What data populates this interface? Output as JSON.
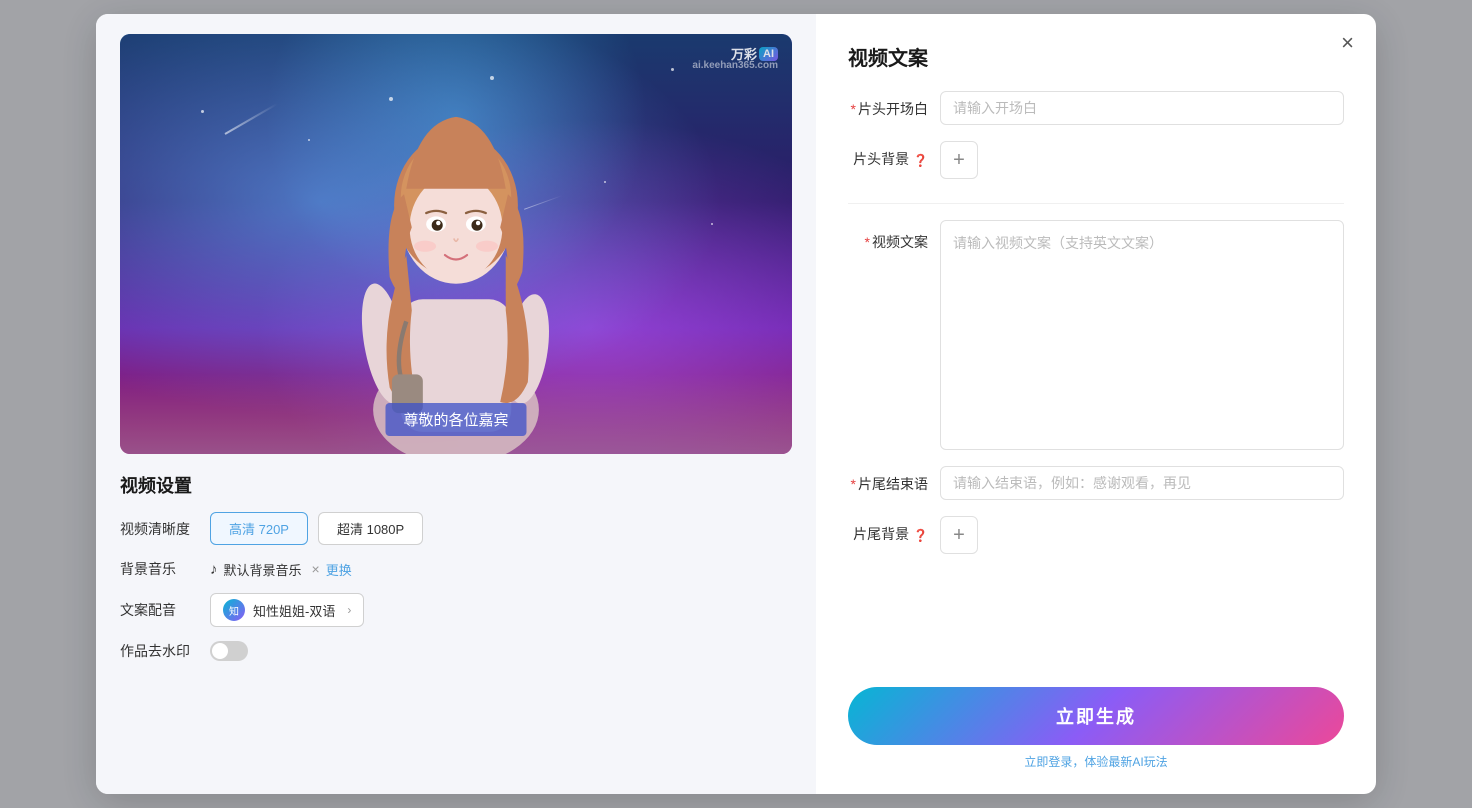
{
  "modal": {
    "close_label": "×",
    "left": {
      "video_preview": {
        "watermark_brand": "万彩",
        "watermark_ai": "AI",
        "watermark_url": "ai.keehan365.com",
        "subtitle": "尊敬的各位嘉宾"
      },
      "settings_title": "视频设置",
      "resolution_label": "视频清晰度",
      "resolution_hd": "高清 720P",
      "resolution_fhd": "超清 1080P",
      "music_label": "背景音乐",
      "music_name": "默认背景音乐",
      "music_change": "更换",
      "voice_label": "文案配音",
      "voice_name": "知性姐姐-双语",
      "watermark_label": "作品去水印"
    },
    "right": {
      "title": "视频文案",
      "opening_label": "片头开场白",
      "opening_required": true,
      "opening_placeholder": "请输入开场白",
      "bg_label": "片头背景",
      "bg_hint": "?",
      "bg_add": "+",
      "content_label": "视频文案",
      "content_required": true,
      "content_placeholder": "请输入视频文案（支持英文文案）",
      "ending_label": "片尾结束语",
      "ending_required": true,
      "ending_placeholder": "请输入结束语，例如：感谢观看，再见",
      "ending_bg_label": "片尾背景",
      "ending_bg_hint": "?",
      "ending_bg_add": "+",
      "generate_btn": "立即生成",
      "login_hint": "立即登录，体验最新AI玩法"
    }
  }
}
